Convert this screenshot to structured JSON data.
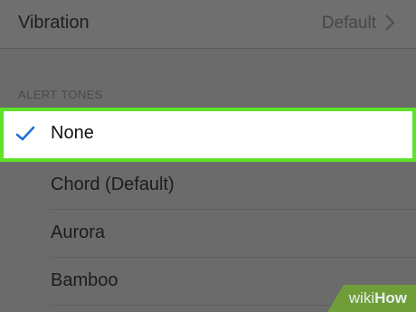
{
  "vibration": {
    "label": "Vibration",
    "value": "Default"
  },
  "alert_tones": {
    "header": "ALERT TONES",
    "selected": "None",
    "items": [
      "Chord (Default)",
      "Aurora",
      "Bamboo"
    ]
  },
  "watermark": {
    "wiki": "wiki",
    "how": "How"
  },
  "colors": {
    "highlight": "#5fe22a",
    "check": "#1a72d6",
    "overlay": "#6b6b6b"
  },
  "icons": {
    "chevron": "chevron-right-icon",
    "check": "checkmark-icon"
  }
}
